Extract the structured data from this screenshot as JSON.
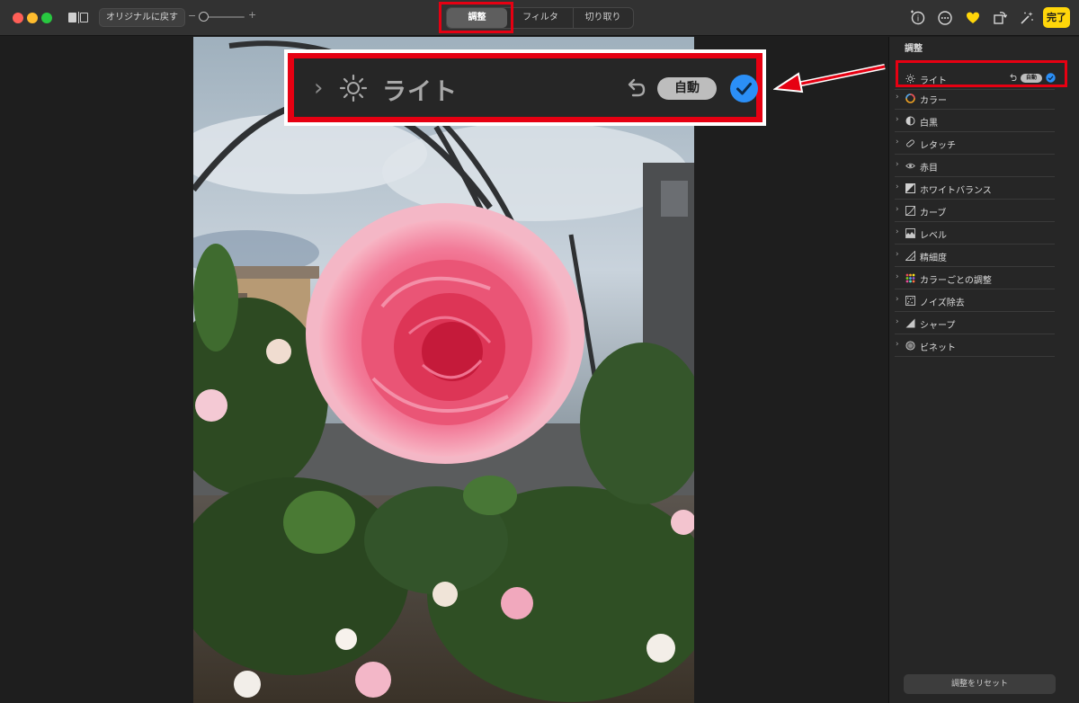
{
  "toolbar": {
    "revert_label": "オリジナルに戻す",
    "zoom_minus": "−",
    "zoom_plus": "+",
    "tabs": [
      {
        "label": "調整",
        "selected": true
      },
      {
        "label": "フィルタ",
        "selected": false
      },
      {
        "label": "切り取り",
        "selected": false
      }
    ],
    "icons": [
      "info-icon",
      "more-icon",
      "favorite-heart-icon",
      "rotate-icon",
      "auto-enhance-wand-icon"
    ],
    "done_label": "完了",
    "done_color": "#ffd60a",
    "favorite_color": "#ffd60a"
  },
  "callout": {
    "label": "ライト",
    "auto_label": "自動"
  },
  "sidebar": {
    "title": "調整",
    "items": [
      {
        "label": "ライト",
        "icon": "sun-icon",
        "auto": "自動"
      },
      {
        "label": "カラー",
        "icon": "color-wheel-icon"
      },
      {
        "label": "白黒",
        "icon": "half-circle-icon"
      },
      {
        "label": "レタッチ",
        "icon": "bandage-icon"
      },
      {
        "label": "赤目",
        "icon": "eye-icon"
      },
      {
        "label": "ホワイトバランス",
        "icon": "white-balance-icon"
      },
      {
        "label": "カーブ",
        "icon": "curve-icon"
      },
      {
        "label": "レベル",
        "icon": "levels-icon"
      },
      {
        "label": "精細度",
        "icon": "definition-icon"
      },
      {
        "label": "カラーごとの調整",
        "icon": "selective-color-icon"
      },
      {
        "label": "ノイズ除去",
        "icon": "noise-icon"
      },
      {
        "label": "シャープ",
        "icon": "sharpen-icon"
      },
      {
        "label": "ビネット",
        "icon": "vignette-icon"
      }
    ],
    "reset_label": "調整をリセット"
  },
  "colors": {
    "highlight": "#e60012",
    "accent_blue": "#2b8ff7"
  }
}
